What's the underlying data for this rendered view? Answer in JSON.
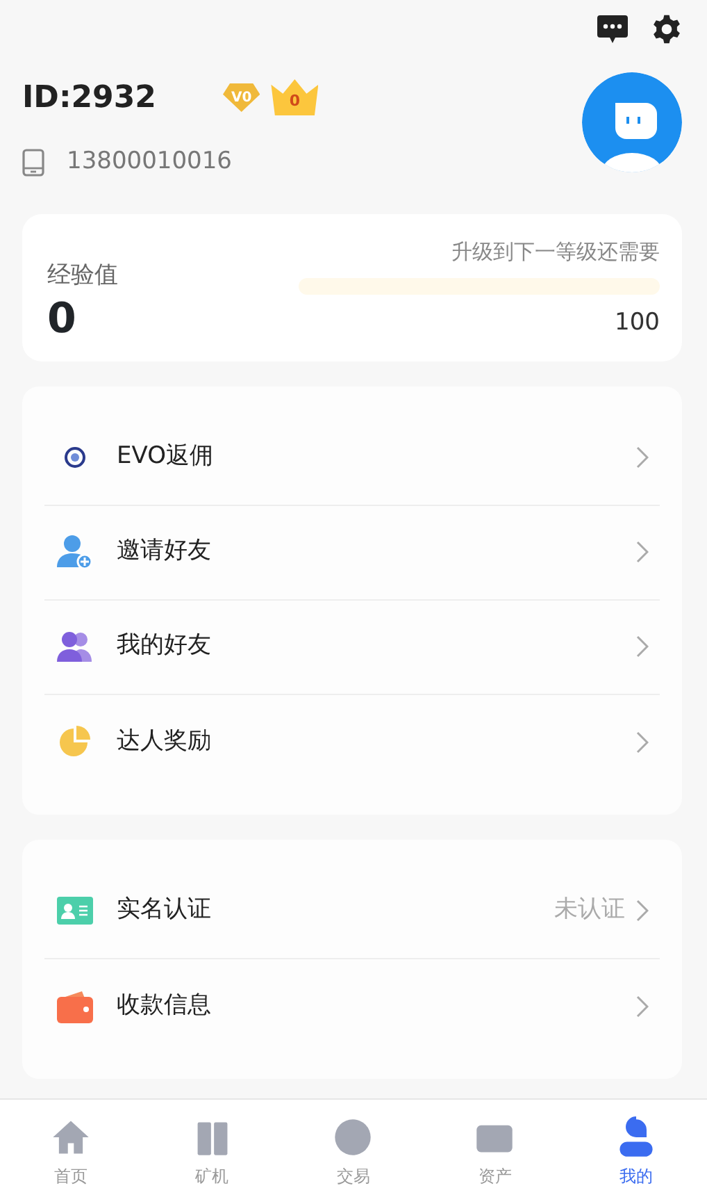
{
  "header": {
    "user_id": "ID:2932",
    "vip_badge": "V0",
    "crown_level": "0",
    "phone": "13800010016"
  },
  "experience": {
    "label": "经验值",
    "value": "0",
    "hint": "升级到下一等级还需要",
    "level": 0,
    "target": "100"
  },
  "menu_groups": [
    {
      "items": [
        {
          "label": "EVO返佣"
        },
        {
          "label": "邀请好友"
        },
        {
          "label": "我的好友"
        },
        {
          "label": "达人奖励"
        }
      ]
    },
    {
      "items": [
        {
          "label": "实名认证",
          "status": "未认证"
        },
        {
          "label": "收款信息"
        }
      ]
    }
  ],
  "tab_bar": [
    {
      "label": "首页",
      "selected": false
    },
    {
      "label": "矿机",
      "selected": false
    },
    {
      "label": "交易",
      "selected": false
    },
    {
      "label": "资产",
      "selected": false
    },
    {
      "label": "我的",
      "selected": true
    }
  ]
}
